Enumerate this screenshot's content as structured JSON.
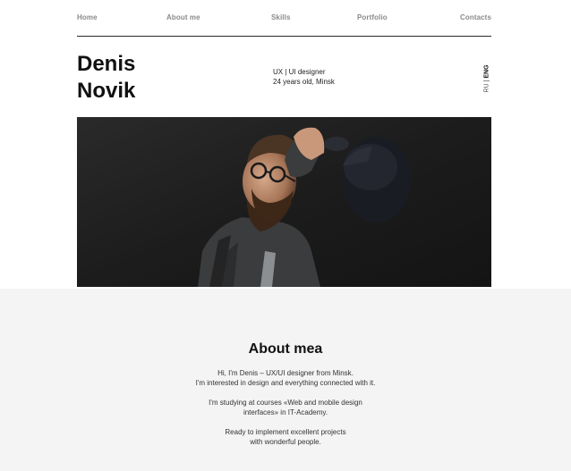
{
  "nav": {
    "items": [
      {
        "label": "Home"
      },
      {
        "label": "About me"
      },
      {
        "label": "Skills"
      },
      {
        "label": "Portfolio"
      },
      {
        "label": "Contacts"
      }
    ]
  },
  "header": {
    "name_line1": "Denis",
    "name_line2": "Novik",
    "role_line1": "UX | UI designer",
    "role_line2": "24 years old, Minsk"
  },
  "language": {
    "options": [
      "RU",
      "ENG"
    ],
    "selected": "ENG",
    "separator": "|"
  },
  "hero": {
    "image": "portrait-photo"
  },
  "about": {
    "title": "About mea",
    "paragraphs": [
      [
        "Hi, I'm Denis – UX/UI designer from Minsk.",
        "I'm interested in design and everything connected with it."
      ],
      [
        "I'm studying at courses «Web and mobile design",
        "interfaces» in IT-Academy."
      ],
      [
        "Ready to implement excellent projects",
        "with wonderful people."
      ]
    ]
  },
  "colors": {
    "nav_text": "#8a8a8a",
    "text": "#111111",
    "about_bg": "#f4f4f4",
    "divider": "#2a2a2a"
  }
}
